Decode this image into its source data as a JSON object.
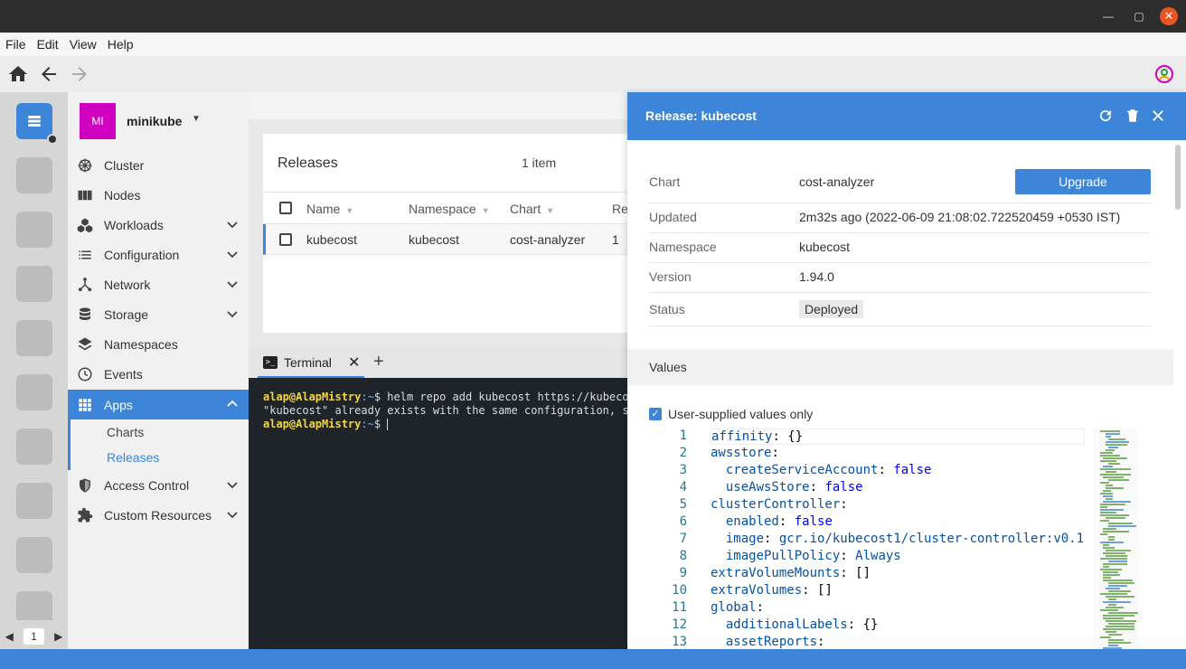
{
  "window": {
    "close_glyph": "✕",
    "maximize_glyph": "▢",
    "minimize_glyph": "—"
  },
  "menu": [
    "File",
    "Edit",
    "View",
    "Help"
  ],
  "hotbar": {
    "page": "1",
    "prev": "◀",
    "next": "▶"
  },
  "cluster": {
    "avatar": "MI",
    "name": "minikube"
  },
  "nav": {
    "cluster": "Cluster",
    "nodes": "Nodes",
    "workloads": "Workloads",
    "configuration": "Configuration",
    "network": "Network",
    "storage": "Storage",
    "namespaces": "Namespaces",
    "events": "Events",
    "apps": "Apps",
    "charts": "Charts",
    "releases": "Releases",
    "access_control": "Access Control",
    "custom_resources": "Custom Resources"
  },
  "releases": {
    "title": "Releases",
    "count": "1 item",
    "columns": [
      "Name",
      "Namespace",
      "Chart",
      "Re"
    ],
    "rows": [
      {
        "name": "kubecost",
        "namespace": "kubecost",
        "chart": "cost-analyzer",
        "revision": "1"
      }
    ]
  },
  "terminal": {
    "tab_label": "Terminal",
    "lines": [
      {
        "user": "alap@AlapMistry",
        "path": ":~",
        "cmd": "$ helm repo add kubecost https://kubecost"
      },
      {
        "text": "\"kubecost\" already exists with the same configuration, ski"
      },
      {
        "user": "alap@AlapMistry",
        "path": ":~",
        "cmd": "$ "
      }
    ]
  },
  "panel": {
    "title": "Release: kubecost",
    "upgrade_label": "Upgrade",
    "details": {
      "chart_label": "Chart",
      "chart_value": "cost-analyzer",
      "updated_label": "Updated",
      "updated_value": "2m32s ago (2022-06-09 21:08:02.722520459 +0530 IST)",
      "namespace_label": "Namespace",
      "namespace_value": "kubecost",
      "version_label": "Version",
      "version_value": "1.94.0",
      "status_label": "Status",
      "status_value": "Deployed"
    },
    "values_label": "Values",
    "user_supplied_label": "User-supplied values only",
    "user_supplied_checked": true,
    "yaml": [
      {
        "n": "1",
        "indent": "",
        "key": "affinity",
        "val": "{}",
        "type": "punct"
      },
      {
        "n": "2",
        "indent": "",
        "key": "awsstore",
        "val": "",
        "type": ""
      },
      {
        "n": "3",
        "indent": "  ",
        "key": "createServiceAccount",
        "val": "false",
        "type": "bool"
      },
      {
        "n": "4",
        "indent": "  ",
        "key": "useAwsStore",
        "val": "false",
        "type": "bool"
      },
      {
        "n": "5",
        "indent": "",
        "key": "clusterController",
        "val": "",
        "type": ""
      },
      {
        "n": "6",
        "indent": "  ",
        "key": "enabled",
        "val": "false",
        "type": "bool"
      },
      {
        "n": "7",
        "indent": "  ",
        "key": "image",
        "val": "gcr.io/kubecost1/cluster-controller:v0.1",
        "type": "str"
      },
      {
        "n": "8",
        "indent": "  ",
        "key": "imagePullPolicy",
        "val": "Always",
        "type": "str"
      },
      {
        "n": "9",
        "indent": "",
        "key": "extraVolumeMounts",
        "val": "[]",
        "type": "punct"
      },
      {
        "n": "10",
        "indent": "",
        "key": "extraVolumes",
        "val": "[]",
        "type": "punct"
      },
      {
        "n": "11",
        "indent": "",
        "key": "global",
        "val": "",
        "type": ""
      },
      {
        "n": "12",
        "indent": "  ",
        "key": "additionalLabels",
        "val": "{}",
        "type": "punct"
      },
      {
        "n": "13",
        "indent": "  ",
        "key": "assetReports",
        "val": "",
        "type": ""
      }
    ]
  },
  "colors": {
    "accent": "#3d85d8",
    "avatar": "#d100c0",
    "terminal_bg": "#1f242b"
  }
}
